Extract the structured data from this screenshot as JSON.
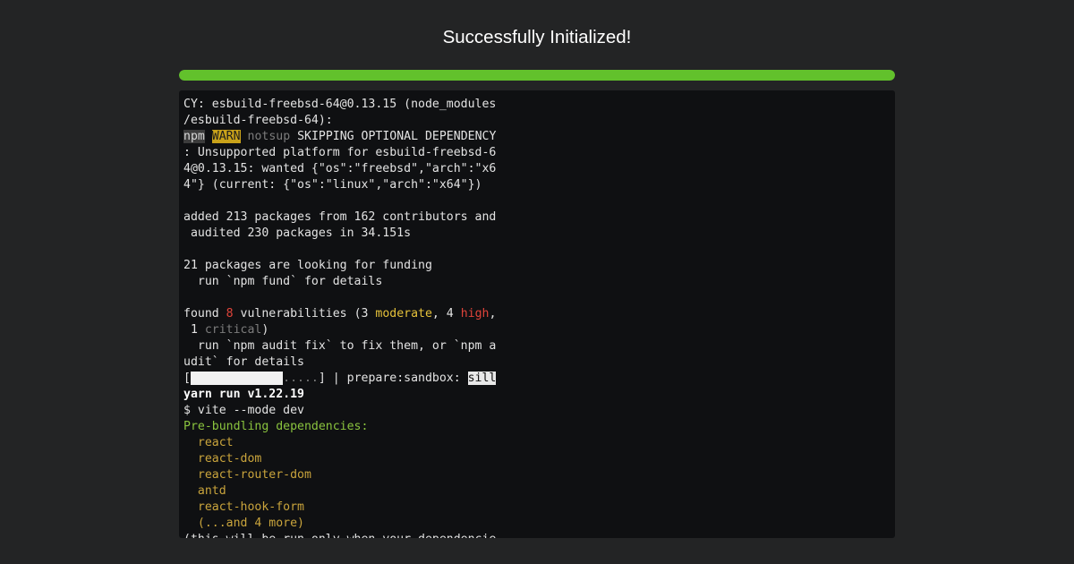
{
  "title": "Successfully Initialized!",
  "progress": {
    "percent": 100,
    "color": "#62c12c"
  },
  "terminal": {
    "lines": [
      [
        {
          "text": "CY: esbuild-freebsd-64@0.13.15 (node_modules"
        }
      ],
      [
        {
          "text": "/esbuild-freebsd-64):"
        }
      ],
      [
        {
          "text": "npm",
          "cls": "badge-npm"
        },
        {
          "text": " "
        },
        {
          "text": "WARN",
          "cls": "badge-warn"
        },
        {
          "text": " "
        },
        {
          "text": "notsup",
          "cls": "seg-gray"
        },
        {
          "text": " SKIPPING OPTIONAL DEPENDENCY"
        }
      ],
      [
        {
          "text": ": Unsupported platform for esbuild-freebsd-6"
        }
      ],
      [
        {
          "text": "4@0.13.15: wanted {\"os\":\"freebsd\",\"arch\":\"x6"
        }
      ],
      [
        {
          "text": "4\"} (current: {\"os\":\"linux\",\"arch\":\"x64\"})"
        }
      ],
      [
        {
          "text": ""
        }
      ],
      [
        {
          "text": "added 213 packages from 162 contributors and"
        }
      ],
      [
        {
          "text": " audited 230 packages in 34.151s"
        }
      ],
      [
        {
          "text": ""
        }
      ],
      [
        {
          "text": "21 packages are looking for funding"
        }
      ],
      [
        {
          "text": "  run `npm fund` for details"
        }
      ],
      [
        {
          "text": ""
        }
      ],
      [
        {
          "text": "found "
        },
        {
          "text": "8",
          "cls": "seg-red"
        },
        {
          "text": " vulnerabilities (3 "
        },
        {
          "text": "moderate",
          "cls": "seg-yellow"
        },
        {
          "text": ", 4 "
        },
        {
          "text": "high",
          "cls": "seg-red"
        },
        {
          "text": ","
        }
      ],
      [
        {
          "text": " 1 "
        },
        {
          "text": "critical",
          "cls": "seg-gray"
        },
        {
          "text": ")"
        }
      ],
      [
        {
          "text": "  run `npm audit fix` to fix them, or `npm a"
        }
      ],
      [
        {
          "text": "udit` for details"
        }
      ],
      [
        {
          "text": "["
        },
        {
          "text": "             ",
          "cls": "bar-fill"
        },
        {
          "text": ".....",
          "cls": "seg-gray"
        },
        {
          "text": "] | prepare:sandbox: "
        },
        {
          "text": "sill",
          "cls": "badge-sill"
        }
      ],
      [
        {
          "text": "yarn run v1.22.19",
          "cls": "seg-bold"
        }
      ],
      [
        {
          "text": "$ vite --mode dev"
        }
      ],
      [
        {
          "text": "Pre-bundling dependencies:",
          "cls": "seg-green"
        }
      ],
      [
        {
          "text": "  "
        },
        {
          "text": "react",
          "cls": "seg-pkg"
        }
      ],
      [
        {
          "text": "  "
        },
        {
          "text": "react-dom",
          "cls": "seg-pkg"
        }
      ],
      [
        {
          "text": "  "
        },
        {
          "text": "react-router-dom",
          "cls": "seg-pkg"
        }
      ],
      [
        {
          "text": "  "
        },
        {
          "text": "antd",
          "cls": "seg-pkg"
        }
      ],
      [
        {
          "text": "  "
        },
        {
          "text": "react-hook-form",
          "cls": "seg-pkg"
        }
      ],
      [
        {
          "text": "  "
        },
        {
          "text": "(...and 4 more)",
          "cls": "seg-pkg"
        }
      ],
      [
        {
          "text": "(this will be run only when your dependencie"
        }
      ]
    ]
  }
}
